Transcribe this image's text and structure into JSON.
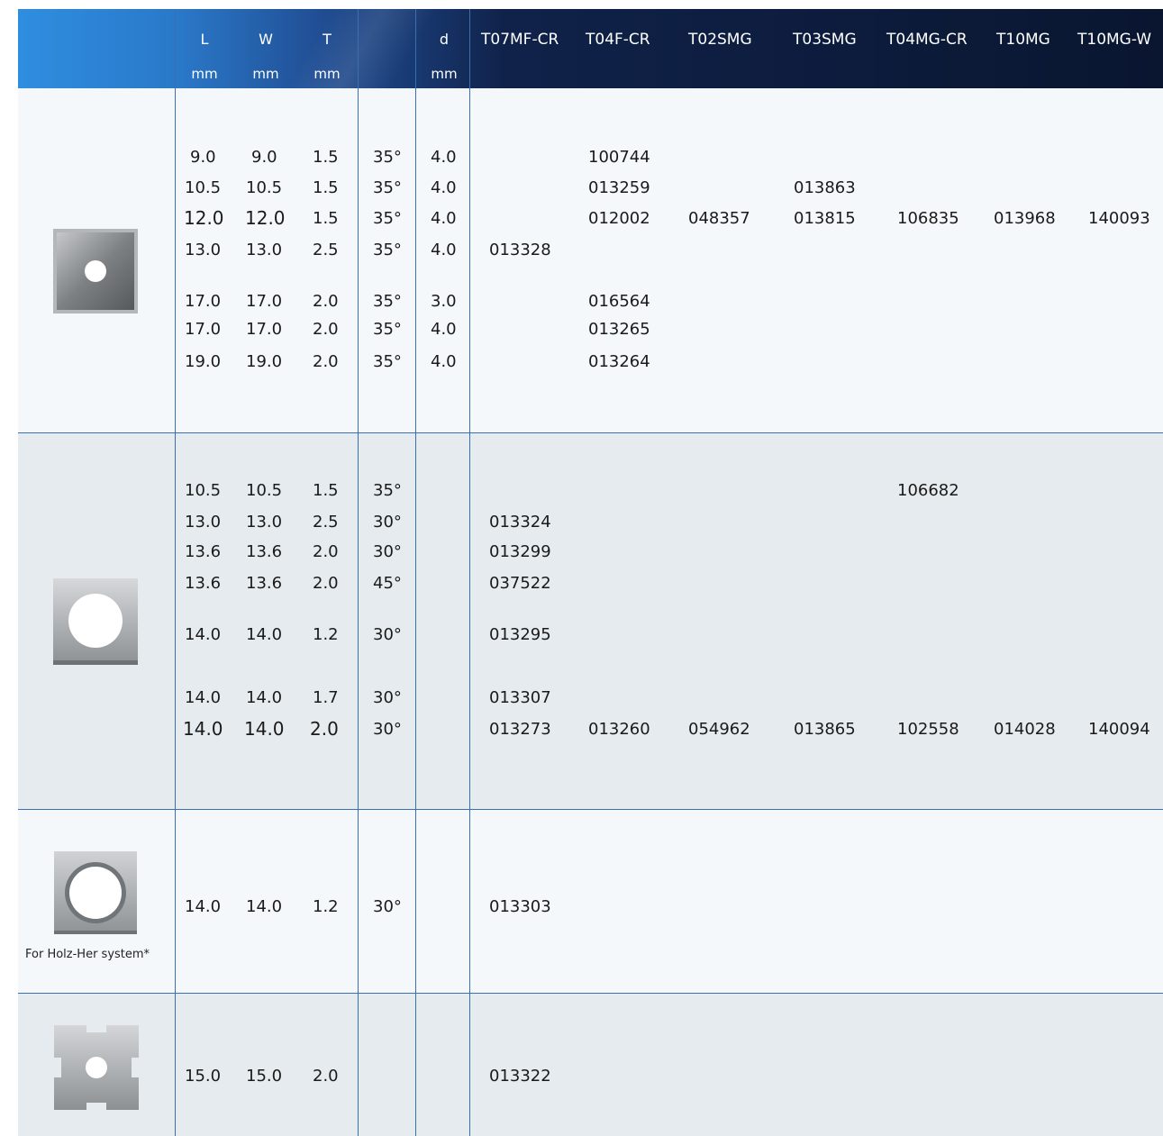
{
  "header": {
    "dims": [
      {
        "label": "L",
        "unit": "mm"
      },
      {
        "label": "W",
        "unit": "mm"
      },
      {
        "label": "T",
        "unit": "mm"
      },
      {
        "label": "",
        "unit": ""
      },
      {
        "label": "d",
        "unit": "mm"
      }
    ],
    "grades": [
      "T07MF-CR",
      "T04F-CR",
      "T02SMG",
      "T03SMG",
      "T04MG-CR",
      "T10MG",
      "T10MG-W"
    ]
  },
  "groups": [
    {
      "rows": [
        {
          "L": "9.0",
          "W": "9.0",
          "T": "1.5",
          "angle": "35°",
          "d": "4.0",
          "codes": [
            "",
            "100744",
            "",
            "",
            "",
            "",
            ""
          ]
        },
        {
          "L": "10.5",
          "W": "10.5",
          "T": "1.5",
          "angle": "35°",
          "d": "4.0",
          "codes": [
            "",
            "013259",
            "",
            "013863",
            "",
            "",
            ""
          ]
        },
        {
          "L": "12.0",
          "W": "12.0",
          "T": "1.5",
          "angle": "35°",
          "d": "4.0",
          "codes": [
            "",
            "012002",
            "048357",
            "013815",
            "106835",
            "013968",
            "140093"
          ]
        },
        {
          "L": "13.0",
          "W": "13.0",
          "T": "2.5",
          "angle": "35°",
          "d": "4.0",
          "codes": [
            "013328",
            "",
            "",
            "",
            "",
            "",
            ""
          ]
        },
        {
          "L": "17.0",
          "W": "17.0",
          "T": "2.0",
          "angle": "35°",
          "d": "3.0",
          "codes": [
            "",
            "016564",
            "",
            "",
            "",
            "",
            ""
          ]
        },
        {
          "L": "17.0",
          "W": "17.0",
          "T": "2.0",
          "angle": "35°",
          "d": "4.0",
          "codes": [
            "",
            "013265",
            "",
            "",
            "",
            "",
            ""
          ]
        },
        {
          "L": "19.0",
          "W": "19.0",
          "T": "2.0",
          "angle": "35°",
          "d": "4.0",
          "codes": [
            "",
            "013264",
            "",
            "",
            "",
            "",
            ""
          ]
        }
      ]
    },
    {
      "rows": [
        {
          "L": "10.5",
          "W": "10.5",
          "T": "1.5",
          "angle": "35°",
          "d": "",
          "codes": [
            "",
            "",
            "",
            "",
            "106682",
            "",
            ""
          ]
        },
        {
          "L": "13.0",
          "W": "13.0",
          "T": "2.5",
          "angle": "30°",
          "d": "",
          "codes": [
            "013324",
            "",
            "",
            "",
            "",
            "",
            ""
          ]
        },
        {
          "L": "13.6",
          "W": "13.6",
          "T": "2.0",
          "angle": "30°",
          "d": "",
          "codes": [
            "013299",
            "",
            "",
            "",
            "",
            "",
            ""
          ]
        },
        {
          "L": "13.6",
          "W": "13.6",
          "T": "2.0",
          "angle": "45°",
          "d": "",
          "codes": [
            "037522",
            "",
            "",
            "",
            "",
            "",
            ""
          ]
        },
        {
          "L": "14.0",
          "W": "14.0",
          "T": "1.2",
          "angle": "30°",
          "d": "",
          "codes": [
            "013295",
            "",
            "",
            "",
            "",
            "",
            ""
          ]
        },
        {
          "L": "14.0",
          "W": "14.0",
          "T": "1.7",
          "angle": "30°",
          "d": "",
          "codes": [
            "013307",
            "",
            "",
            "",
            "",
            "",
            ""
          ]
        },
        {
          "L": "14.0",
          "W": "14.0",
          "T": "2.0",
          "angle": "30°",
          "d": "",
          "codes": [
            "013273",
            "013260",
            "054962",
            "013865",
            "102558",
            "014028",
            "140094"
          ]
        }
      ]
    },
    {
      "note": "For Holz-Her system*",
      "rows": [
        {
          "L": "14.0",
          "W": "14.0",
          "T": "1.2",
          "angle": "30°",
          "d": "",
          "codes": [
            "013303",
            "",
            "",
            "",
            "",
            "",
            ""
          ]
        }
      ]
    },
    {
      "rows": [
        {
          "L": "15.0",
          "W": "15.0",
          "T": "2.0",
          "angle": "",
          "d": "",
          "codes": [
            "013322",
            "",
            "",
            "",
            "",
            "",
            ""
          ]
        }
      ]
    }
  ]
}
